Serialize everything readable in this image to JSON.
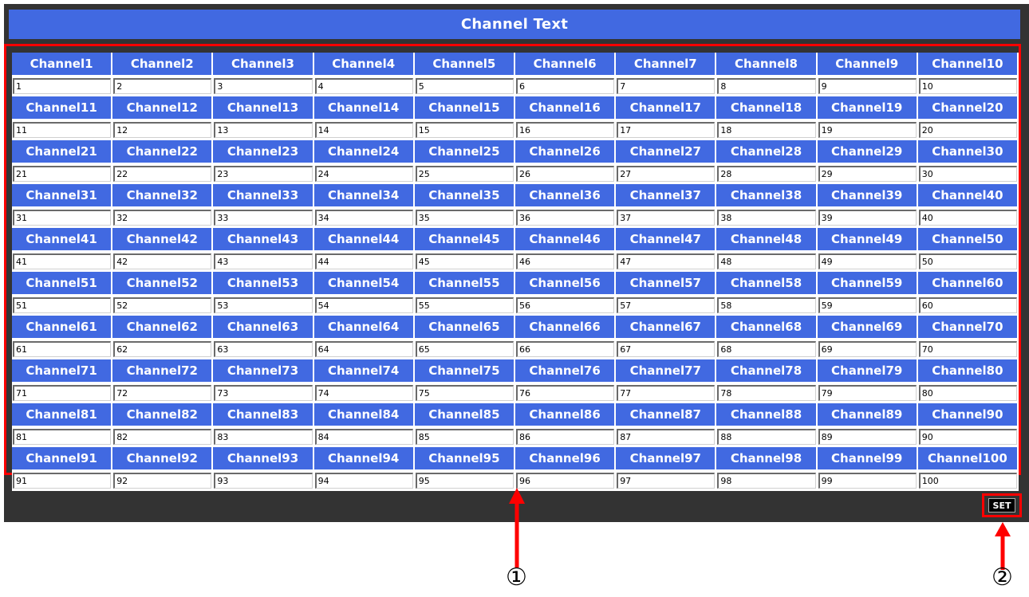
{
  "header": {
    "title": "Channel Text"
  },
  "channels": [
    {
      "label": "Channel1",
      "value": "1"
    },
    {
      "label": "Channel2",
      "value": "2"
    },
    {
      "label": "Channel3",
      "value": "3"
    },
    {
      "label": "Channel4",
      "value": "4"
    },
    {
      "label": "Channel5",
      "value": "5"
    },
    {
      "label": "Channel6",
      "value": "6"
    },
    {
      "label": "Channel7",
      "value": "7"
    },
    {
      "label": "Channel8",
      "value": "8"
    },
    {
      "label": "Channel9",
      "value": "9"
    },
    {
      "label": "Channel10",
      "value": "10"
    },
    {
      "label": "Channel11",
      "value": "11"
    },
    {
      "label": "Channel12",
      "value": "12"
    },
    {
      "label": "Channel13",
      "value": "13"
    },
    {
      "label": "Channel14",
      "value": "14"
    },
    {
      "label": "Channel15",
      "value": "15"
    },
    {
      "label": "Channel16",
      "value": "16"
    },
    {
      "label": "Channel17",
      "value": "17"
    },
    {
      "label": "Channel18",
      "value": "18"
    },
    {
      "label": "Channel19",
      "value": "19"
    },
    {
      "label": "Channel20",
      "value": "20"
    },
    {
      "label": "Channel21",
      "value": "21"
    },
    {
      "label": "Channel22",
      "value": "22"
    },
    {
      "label": "Channel23",
      "value": "23"
    },
    {
      "label": "Channel24",
      "value": "24"
    },
    {
      "label": "Channel25",
      "value": "25"
    },
    {
      "label": "Channel26",
      "value": "26"
    },
    {
      "label": "Channel27",
      "value": "27"
    },
    {
      "label": "Channel28",
      "value": "28"
    },
    {
      "label": "Channel29",
      "value": "29"
    },
    {
      "label": "Channel30",
      "value": "30"
    },
    {
      "label": "Channel31",
      "value": "31"
    },
    {
      "label": "Channel32",
      "value": "32"
    },
    {
      "label": "Channel33",
      "value": "33"
    },
    {
      "label": "Channel34",
      "value": "34"
    },
    {
      "label": "Channel35",
      "value": "35"
    },
    {
      "label": "Channel36",
      "value": "36"
    },
    {
      "label": "Channel37",
      "value": "37"
    },
    {
      "label": "Channel38",
      "value": "38"
    },
    {
      "label": "Channel39",
      "value": "39"
    },
    {
      "label": "Channel40",
      "value": "40"
    },
    {
      "label": "Channel41",
      "value": "41"
    },
    {
      "label": "Channel42",
      "value": "42"
    },
    {
      "label": "Channel43",
      "value": "43"
    },
    {
      "label": "Channel44",
      "value": "44"
    },
    {
      "label": "Channel45",
      "value": "45"
    },
    {
      "label": "Channel46",
      "value": "46"
    },
    {
      "label": "Channel47",
      "value": "47"
    },
    {
      "label": "Channel48",
      "value": "48"
    },
    {
      "label": "Channel49",
      "value": "49"
    },
    {
      "label": "Channel50",
      "value": "50"
    },
    {
      "label": "Channel51",
      "value": "51"
    },
    {
      "label": "Channel52",
      "value": "52"
    },
    {
      "label": "Channel53",
      "value": "53"
    },
    {
      "label": "Channel54",
      "value": "54"
    },
    {
      "label": "Channel55",
      "value": "55"
    },
    {
      "label": "Channel56",
      "value": "56"
    },
    {
      "label": "Channel57",
      "value": "57"
    },
    {
      "label": "Channel58",
      "value": "58"
    },
    {
      "label": "Channel59",
      "value": "59"
    },
    {
      "label": "Channel60",
      "value": "60"
    },
    {
      "label": "Channel61",
      "value": "61"
    },
    {
      "label": "Channel62",
      "value": "62"
    },
    {
      "label": "Channel63",
      "value": "63"
    },
    {
      "label": "Channel64",
      "value": "64"
    },
    {
      "label": "Channel65",
      "value": "65"
    },
    {
      "label": "Channel66",
      "value": "66"
    },
    {
      "label": "Channel67",
      "value": "67"
    },
    {
      "label": "Channel68",
      "value": "68"
    },
    {
      "label": "Channel69",
      "value": "69"
    },
    {
      "label": "Channel70",
      "value": "70"
    },
    {
      "label": "Channel71",
      "value": "71"
    },
    {
      "label": "Channel72",
      "value": "72"
    },
    {
      "label": "Channel73",
      "value": "73"
    },
    {
      "label": "Channel74",
      "value": "74"
    },
    {
      "label": "Channel75",
      "value": "75"
    },
    {
      "label": "Channel76",
      "value": "76"
    },
    {
      "label": "Channel77",
      "value": "77"
    },
    {
      "label": "Channel78",
      "value": "78"
    },
    {
      "label": "Channel79",
      "value": "79"
    },
    {
      "label": "Channel80",
      "value": "80"
    },
    {
      "label": "Channel81",
      "value": "81"
    },
    {
      "label": "Channel82",
      "value": "82"
    },
    {
      "label": "Channel83",
      "value": "83"
    },
    {
      "label": "Channel84",
      "value": "84"
    },
    {
      "label": "Channel85",
      "value": "85"
    },
    {
      "label": "Channel86",
      "value": "86"
    },
    {
      "label": "Channel87",
      "value": "87"
    },
    {
      "label": "Channel88",
      "value": "88"
    },
    {
      "label": "Channel89",
      "value": "89"
    },
    {
      "label": "Channel90",
      "value": "90"
    },
    {
      "label": "Channel91",
      "value": "91"
    },
    {
      "label": "Channel92",
      "value": "92"
    },
    {
      "label": "Channel93",
      "value": "93"
    },
    {
      "label": "Channel94",
      "value": "94"
    },
    {
      "label": "Channel95",
      "value": "95"
    },
    {
      "label": "Channel96",
      "value": "96"
    },
    {
      "label": "Channel97",
      "value": "97"
    },
    {
      "label": "Channel98",
      "value": "98"
    },
    {
      "label": "Channel99",
      "value": "99"
    },
    {
      "label": "Channel100",
      "value": "100"
    }
  ],
  "toolbar": {
    "set_label": "SET"
  },
  "annotations": {
    "callout_grid": "①",
    "callout_set": "②"
  },
  "colors": {
    "header_blue": "#4169e1",
    "panel_dark": "#333333",
    "highlight_red": "#ff0000"
  }
}
